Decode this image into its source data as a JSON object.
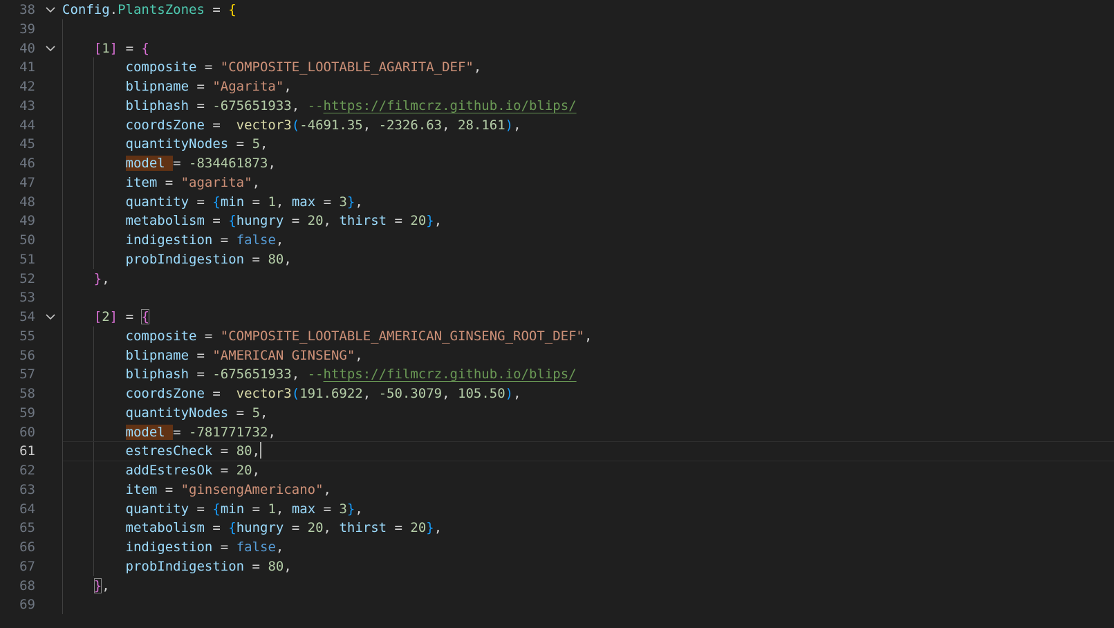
{
  "editor": {
    "current_line": 61,
    "theme": {
      "background": "#1f1f1f",
      "string": "#ce9178",
      "number": "#b5cea8",
      "keyword": "#569cd6",
      "comment": "#6a9955"
    },
    "lines": [
      {
        "n": 38,
        "fold": true,
        "indent": 0,
        "tokens": [
          {
            "t": "Config",
            "c": "id"
          },
          {
            "t": ".",
            "c": "p"
          },
          {
            "t": "PlantsZones",
            "c": "fld"
          },
          {
            "t": " = ",
            "c": "op"
          },
          {
            "t": "{",
            "c": "b1"
          }
        ]
      },
      {
        "n": 39,
        "fold": false,
        "indent": 0,
        "tokens": []
      },
      {
        "n": 40,
        "fold": true,
        "indent": 1,
        "tokens": [
          {
            "t": "[",
            "c": "b2"
          },
          {
            "t": "1",
            "c": "num"
          },
          {
            "t": "]",
            "c": "b2"
          },
          {
            "t": " = ",
            "c": "op"
          },
          {
            "t": "{",
            "c": "b2"
          }
        ]
      },
      {
        "n": 41,
        "fold": false,
        "indent": 2,
        "tokens": [
          {
            "t": "composite",
            "c": "id"
          },
          {
            "t": " = ",
            "c": "op"
          },
          {
            "t": "\"COMPOSITE_LOOTABLE_AGARITA_DEF\"",
            "c": "str"
          },
          {
            "t": ",",
            "c": "p"
          }
        ]
      },
      {
        "n": 42,
        "fold": false,
        "indent": 2,
        "tokens": [
          {
            "t": "blipname",
            "c": "id"
          },
          {
            "t": " = ",
            "c": "op"
          },
          {
            "t": "\"Agarita\"",
            "c": "str"
          },
          {
            "t": ",",
            "c": "p"
          }
        ]
      },
      {
        "n": 43,
        "fold": false,
        "indent": 2,
        "tokens": [
          {
            "t": "bliphash",
            "c": "id"
          },
          {
            "t": " = ",
            "c": "op"
          },
          {
            "t": "-675651933",
            "c": "num"
          },
          {
            "t": ", ",
            "c": "p"
          },
          {
            "t": "--",
            "c": "cm"
          },
          {
            "t": "https://filmcrz.github.io/blips/",
            "c": "url"
          }
        ]
      },
      {
        "n": 44,
        "fold": false,
        "indent": 2,
        "tokens": [
          {
            "t": "coordsZone",
            "c": "id"
          },
          {
            "t": " =  ",
            "c": "op"
          },
          {
            "t": "vector3",
            "c": "fn"
          },
          {
            "t": "(",
            "c": "b3"
          },
          {
            "t": "-4691.35",
            "c": "num"
          },
          {
            "t": ", ",
            "c": "p"
          },
          {
            "t": "-2326.63",
            "c": "num"
          },
          {
            "t": ", ",
            "c": "p"
          },
          {
            "t": "28.161",
            "c": "num"
          },
          {
            "t": ")",
            "c": "b3"
          },
          {
            "t": ",",
            "c": "p"
          }
        ]
      },
      {
        "n": 45,
        "fold": false,
        "indent": 2,
        "tokens": [
          {
            "t": "quantityNodes",
            "c": "id"
          },
          {
            "t": " = ",
            "c": "op"
          },
          {
            "t": "5",
            "c": "num"
          },
          {
            "t": ",",
            "c": "p"
          }
        ]
      },
      {
        "n": 46,
        "fold": false,
        "indent": 2,
        "tokens": [
          {
            "t": "model ",
            "c": "id hl"
          },
          {
            "t": "= ",
            "c": "op"
          },
          {
            "t": "-834461873",
            "c": "num"
          },
          {
            "t": ",",
            "c": "p"
          }
        ]
      },
      {
        "n": 47,
        "fold": false,
        "indent": 2,
        "tokens": [
          {
            "t": "item",
            "c": "id"
          },
          {
            "t": " = ",
            "c": "op"
          },
          {
            "t": "\"agarita\"",
            "c": "str"
          },
          {
            "t": ",",
            "c": "p"
          }
        ]
      },
      {
        "n": 48,
        "fold": false,
        "indent": 2,
        "tokens": [
          {
            "t": "quantity",
            "c": "id"
          },
          {
            "t": " = ",
            "c": "op"
          },
          {
            "t": "{",
            "c": "b3"
          },
          {
            "t": "min",
            "c": "id"
          },
          {
            "t": " = ",
            "c": "op"
          },
          {
            "t": "1",
            "c": "num"
          },
          {
            "t": ", ",
            "c": "p"
          },
          {
            "t": "max",
            "c": "id"
          },
          {
            "t": " = ",
            "c": "op"
          },
          {
            "t": "3",
            "c": "num"
          },
          {
            "t": "}",
            "c": "b3"
          },
          {
            "t": ",",
            "c": "p"
          }
        ]
      },
      {
        "n": 49,
        "fold": false,
        "indent": 2,
        "tokens": [
          {
            "t": "metabolism",
            "c": "id"
          },
          {
            "t": " = ",
            "c": "op"
          },
          {
            "t": "{",
            "c": "b3"
          },
          {
            "t": "hungry",
            "c": "id"
          },
          {
            "t": " = ",
            "c": "op"
          },
          {
            "t": "20",
            "c": "num"
          },
          {
            "t": ", ",
            "c": "p"
          },
          {
            "t": "thirst",
            "c": "id"
          },
          {
            "t": " = ",
            "c": "op"
          },
          {
            "t": "20",
            "c": "num"
          },
          {
            "t": "}",
            "c": "b3"
          },
          {
            "t": ",",
            "c": "p"
          }
        ]
      },
      {
        "n": 50,
        "fold": false,
        "indent": 2,
        "tokens": [
          {
            "t": "indigestion",
            "c": "id"
          },
          {
            "t": " = ",
            "c": "op"
          },
          {
            "t": "false",
            "c": "kw"
          },
          {
            "t": ",",
            "c": "p"
          }
        ]
      },
      {
        "n": 51,
        "fold": false,
        "indent": 2,
        "tokens": [
          {
            "t": "probIndigestion",
            "c": "id"
          },
          {
            "t": " = ",
            "c": "op"
          },
          {
            "t": "80",
            "c": "num"
          },
          {
            "t": ",",
            "c": "p"
          }
        ]
      },
      {
        "n": 52,
        "fold": false,
        "indent": 1,
        "tokens": [
          {
            "t": "}",
            "c": "b2"
          },
          {
            "t": ",",
            "c": "p"
          }
        ]
      },
      {
        "n": 53,
        "fold": false,
        "indent": 0,
        "tokens": []
      },
      {
        "n": 54,
        "fold": true,
        "indent": 1,
        "tokens": [
          {
            "t": "[",
            "c": "b2"
          },
          {
            "t": "2",
            "c": "num"
          },
          {
            "t": "]",
            "c": "b2"
          },
          {
            "t": " = ",
            "c": "op"
          },
          {
            "t": "{",
            "c": "b2 bm"
          }
        ]
      },
      {
        "n": 55,
        "fold": false,
        "indent": 2,
        "tokens": [
          {
            "t": "composite",
            "c": "id"
          },
          {
            "t": " = ",
            "c": "op"
          },
          {
            "t": "\"COMPOSITE_LOOTABLE_AMERICAN_GINSENG_ROOT_DEF\"",
            "c": "str"
          },
          {
            "t": ",",
            "c": "p"
          }
        ]
      },
      {
        "n": 56,
        "fold": false,
        "indent": 2,
        "tokens": [
          {
            "t": "blipname",
            "c": "id"
          },
          {
            "t": " = ",
            "c": "op"
          },
          {
            "t": "\"AMERICAN GINSENG\"",
            "c": "str"
          },
          {
            "t": ",",
            "c": "p"
          }
        ]
      },
      {
        "n": 57,
        "fold": false,
        "indent": 2,
        "tokens": [
          {
            "t": "bliphash",
            "c": "id"
          },
          {
            "t": " = ",
            "c": "op"
          },
          {
            "t": "-675651933",
            "c": "num"
          },
          {
            "t": ", ",
            "c": "p"
          },
          {
            "t": "--",
            "c": "cm"
          },
          {
            "t": "https://filmcrz.github.io/blips/",
            "c": "url"
          }
        ]
      },
      {
        "n": 58,
        "fold": false,
        "indent": 2,
        "tokens": [
          {
            "t": "coordsZone",
            "c": "id"
          },
          {
            "t": " =  ",
            "c": "op"
          },
          {
            "t": "vector3",
            "c": "fn"
          },
          {
            "t": "(",
            "c": "b3"
          },
          {
            "t": "191.6922",
            "c": "num"
          },
          {
            "t": ", ",
            "c": "p"
          },
          {
            "t": "-50.3079",
            "c": "num"
          },
          {
            "t": ", ",
            "c": "p"
          },
          {
            "t": "105.50",
            "c": "num"
          },
          {
            "t": ")",
            "c": "b3"
          },
          {
            "t": ",",
            "c": "p"
          }
        ]
      },
      {
        "n": 59,
        "fold": false,
        "indent": 2,
        "tokens": [
          {
            "t": "quantityNodes",
            "c": "id"
          },
          {
            "t": " = ",
            "c": "op"
          },
          {
            "t": "5",
            "c": "num"
          },
          {
            "t": ",",
            "c": "p"
          }
        ]
      },
      {
        "n": 60,
        "fold": false,
        "indent": 2,
        "tokens": [
          {
            "t": "model ",
            "c": "id hl"
          },
          {
            "t": "= ",
            "c": "op"
          },
          {
            "t": "-781771732",
            "c": "num"
          },
          {
            "t": ",",
            "c": "p"
          }
        ]
      },
      {
        "n": 61,
        "fold": false,
        "indent": 2,
        "cursor": true,
        "tokens": [
          {
            "t": "estresCheck",
            "c": "id"
          },
          {
            "t": " = ",
            "c": "op"
          },
          {
            "t": "80",
            "c": "num"
          },
          {
            "t": ",",
            "c": "p"
          }
        ]
      },
      {
        "n": 62,
        "fold": false,
        "indent": 2,
        "tokens": [
          {
            "t": "addEstresOk",
            "c": "id"
          },
          {
            "t": " = ",
            "c": "op"
          },
          {
            "t": "20",
            "c": "num"
          },
          {
            "t": ",",
            "c": "p"
          }
        ]
      },
      {
        "n": 63,
        "fold": false,
        "indent": 2,
        "tokens": [
          {
            "t": "item",
            "c": "id"
          },
          {
            "t": " = ",
            "c": "op"
          },
          {
            "t": "\"ginsengAmericano\"",
            "c": "str"
          },
          {
            "t": ",",
            "c": "p"
          }
        ]
      },
      {
        "n": 64,
        "fold": false,
        "indent": 2,
        "tokens": [
          {
            "t": "quantity",
            "c": "id"
          },
          {
            "t": " = ",
            "c": "op"
          },
          {
            "t": "{",
            "c": "b3"
          },
          {
            "t": "min",
            "c": "id"
          },
          {
            "t": " = ",
            "c": "op"
          },
          {
            "t": "1",
            "c": "num"
          },
          {
            "t": ", ",
            "c": "p"
          },
          {
            "t": "max",
            "c": "id"
          },
          {
            "t": " = ",
            "c": "op"
          },
          {
            "t": "3",
            "c": "num"
          },
          {
            "t": "}",
            "c": "b3"
          },
          {
            "t": ",",
            "c": "p"
          }
        ]
      },
      {
        "n": 65,
        "fold": false,
        "indent": 2,
        "tokens": [
          {
            "t": "metabolism",
            "c": "id"
          },
          {
            "t": " = ",
            "c": "op"
          },
          {
            "t": "{",
            "c": "b3"
          },
          {
            "t": "hungry",
            "c": "id"
          },
          {
            "t": " = ",
            "c": "op"
          },
          {
            "t": "20",
            "c": "num"
          },
          {
            "t": ", ",
            "c": "p"
          },
          {
            "t": "thirst",
            "c": "id"
          },
          {
            "t": " = ",
            "c": "op"
          },
          {
            "t": "20",
            "c": "num"
          },
          {
            "t": "}",
            "c": "b3"
          },
          {
            "t": ",",
            "c": "p"
          }
        ]
      },
      {
        "n": 66,
        "fold": false,
        "indent": 2,
        "tokens": [
          {
            "t": "indigestion",
            "c": "id"
          },
          {
            "t": " = ",
            "c": "op"
          },
          {
            "t": "false",
            "c": "kw"
          },
          {
            "t": ",",
            "c": "p"
          }
        ]
      },
      {
        "n": 67,
        "fold": false,
        "indent": 2,
        "tokens": [
          {
            "t": "probIndigestion",
            "c": "id"
          },
          {
            "t": " = ",
            "c": "op"
          },
          {
            "t": "80",
            "c": "num"
          },
          {
            "t": ",",
            "c": "p"
          }
        ]
      },
      {
        "n": 68,
        "fold": false,
        "indent": 1,
        "tokens": [
          {
            "t": "}",
            "c": "b2 bm"
          },
          {
            "t": ",",
            "c": "p"
          }
        ]
      },
      {
        "n": 69,
        "fold": false,
        "indent": 0,
        "tokens": []
      }
    ]
  }
}
